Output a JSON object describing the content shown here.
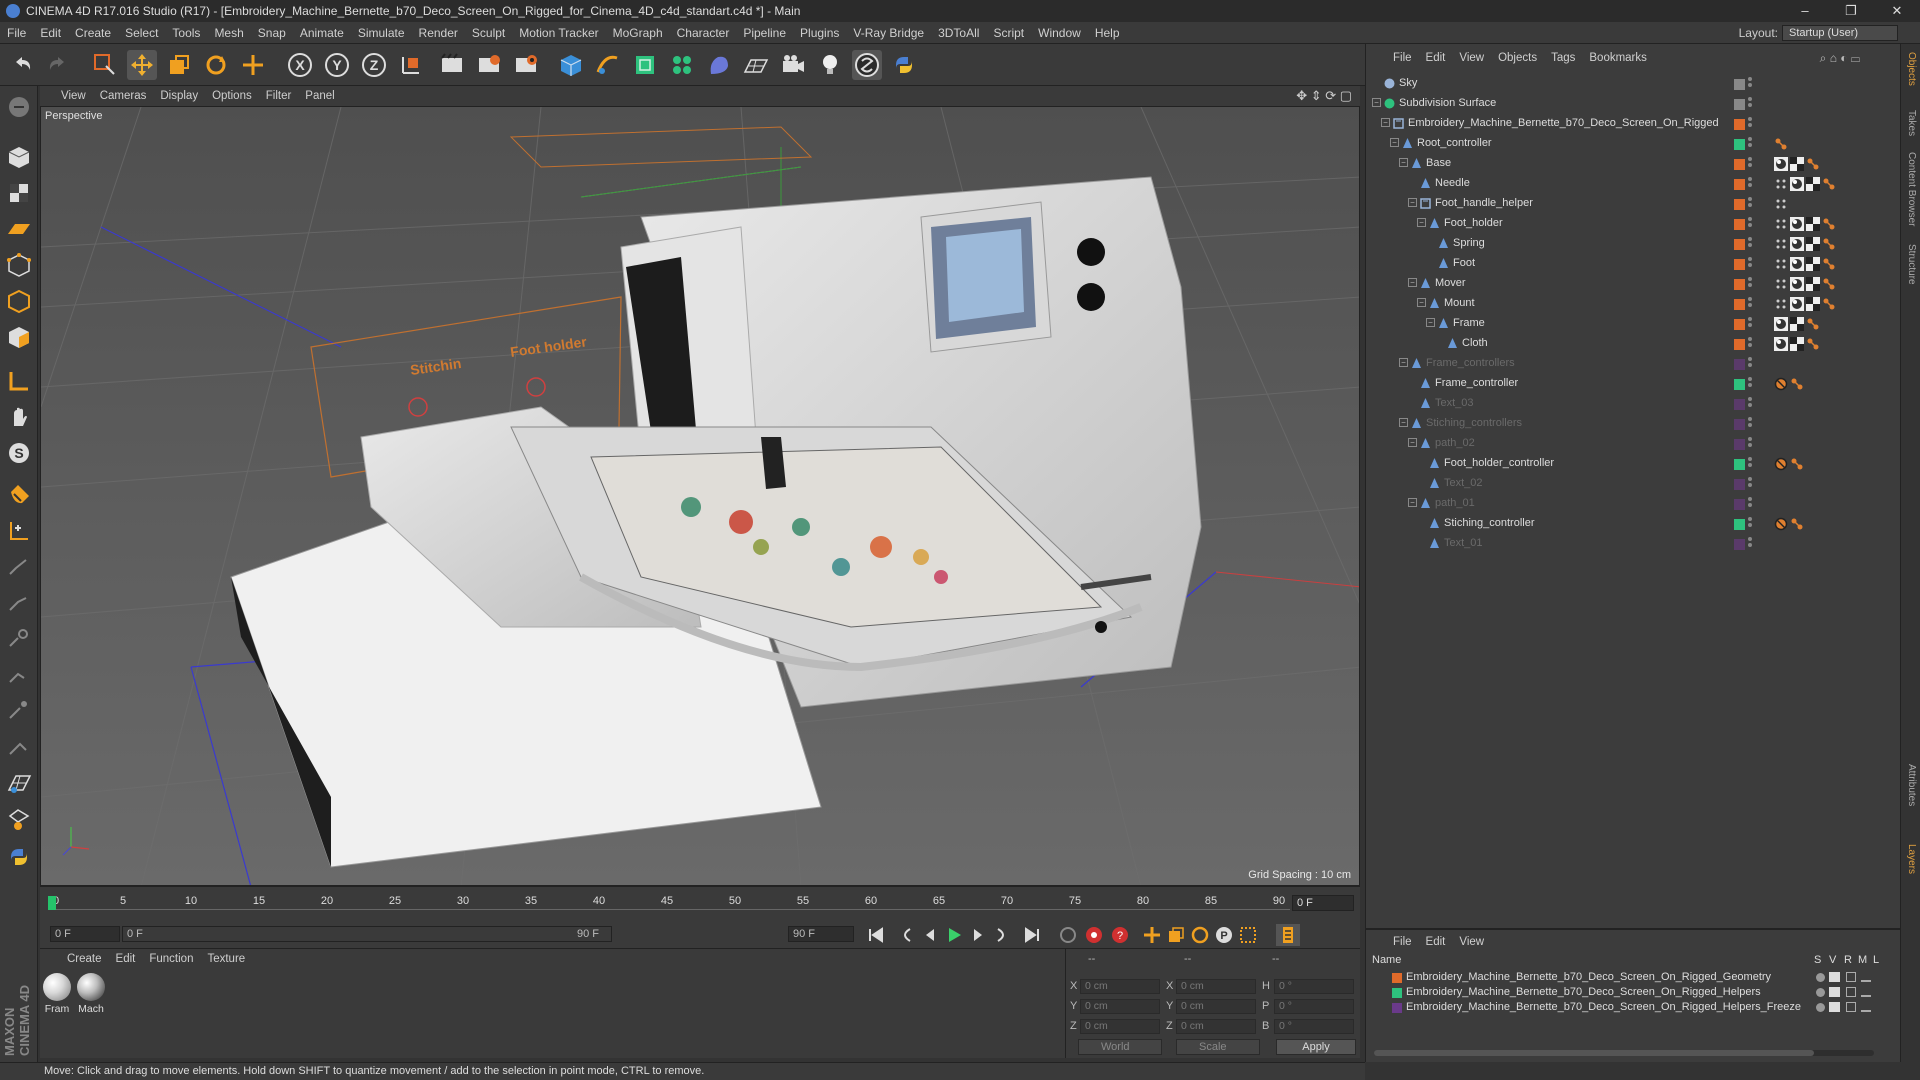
{
  "window": {
    "title": "CINEMA 4D R17.016 Studio (R17) - [Embroidery_Machine_Bernette_b70_Deco_Screen_On_Rigged_for_Cinema_4D_c4d_standart.c4d *] - Main",
    "minimize": "–",
    "maximize": "❐",
    "close": "✕"
  },
  "menubar": {
    "items": [
      "File",
      "Edit",
      "Create",
      "Select",
      "Tools",
      "Mesh",
      "Snap",
      "Animate",
      "Simulate",
      "Render",
      "Sculpt",
      "Motion Tracker",
      "MoGraph",
      "Character",
      "Pipeline",
      "Plugins",
      "V-Ray Bridge",
      "3DToAll",
      "Script",
      "Window",
      "Help"
    ],
    "layout_label": "Layout:",
    "layout_value": "Startup (User)"
  },
  "viewport": {
    "menu": [
      "View",
      "Cameras",
      "Display",
      "Options",
      "Filter",
      "Panel"
    ],
    "label": "Perspective",
    "grid_spacing": "Grid Spacing : 10 cm",
    "overlay_labels": [
      "Stitchin",
      "Foot holder"
    ]
  },
  "timeline": {
    "ticks": [
      "0",
      "5",
      "10",
      "15",
      "20",
      "25",
      "30",
      "35",
      "40",
      "45",
      "50",
      "55",
      "60",
      "65",
      "70",
      "75",
      "80",
      "85",
      "90"
    ],
    "current_frame": "0 F"
  },
  "transport": {
    "start_frame": "0 F",
    "slider_start": "0 F",
    "slider_end": "90 F",
    "end_frame": "90 F"
  },
  "materials": {
    "menu": [
      "Create",
      "Edit",
      "Function",
      "Texture"
    ],
    "items": [
      {
        "label": "Fram",
        "color": "#d8d8d8"
      },
      {
        "label": "Mach",
        "color": "#bdbdbd"
      }
    ]
  },
  "coordinates": {
    "header": [
      "--",
      "--",
      "--"
    ],
    "rows": [
      {
        "a": "X",
        "av": "0 cm",
        "b": "X",
        "bv": "0 cm",
        "c": "H",
        "cv": "0 °"
      },
      {
        "a": "Y",
        "av": "0 cm",
        "b": "Y",
        "bv": "0 cm",
        "c": "P",
        "cv": "0 °"
      },
      {
        "a": "Z",
        "av": "0 cm",
        "b": "Z",
        "bv": "0 cm",
        "c": "B",
        "cv": "0 °"
      }
    ],
    "world": "World",
    "scale": "Scale",
    "apply": "Apply"
  },
  "status": "Move: Click and drag to move elements. Hold down SHIFT to quantize movement / add to the selection in point mode, CTRL to remove.",
  "object_manager": {
    "menu": [
      "File",
      "Edit",
      "View",
      "Objects",
      "Tags",
      "Bookmarks"
    ],
    "objects": [
      {
        "name": "Sky",
        "level": 0,
        "color": "#888888",
        "type": "sky",
        "dim": false,
        "tags": []
      },
      {
        "name": "Subdivision Surface",
        "level": 0,
        "color": "#888888",
        "type": "subdiv",
        "dim": false,
        "tags": []
      },
      {
        "name": "Embroidery_Machine_Bernette_b70_Deco_Screen_On_Rigged",
        "level": 1,
        "color": "#e06a2a",
        "type": "null",
        "dim": false,
        "tags": []
      },
      {
        "name": "Root_controller",
        "level": 2,
        "color": "#2ec27e",
        "type": "joint",
        "dim": false,
        "tags": [
          "ik"
        ]
      },
      {
        "name": "Base",
        "level": 3,
        "color": "#e06a2a",
        "type": "joint",
        "dim": false,
        "tags": [
          "phong",
          "checker",
          "ik"
        ]
      },
      {
        "name": "Needle",
        "level": 4,
        "color": "#e06a2a",
        "type": "joint",
        "dim": false,
        "tags": [
          "dots",
          "phong",
          "checker",
          "ik"
        ]
      },
      {
        "name": "Foot_handle_helper",
        "level": 4,
        "color": "#e06a2a",
        "type": "null",
        "dim": false,
        "tags": [
          "dots"
        ]
      },
      {
        "name": "Foot_holder",
        "level": 5,
        "color": "#e06a2a",
        "type": "joint",
        "dim": false,
        "tags": [
          "dots",
          "phong",
          "checker",
          "ik"
        ]
      },
      {
        "name": "Spring",
        "level": 6,
        "color": "#e06a2a",
        "type": "joint",
        "dim": false,
        "tags": [
          "dots",
          "phong",
          "checker",
          "ik"
        ]
      },
      {
        "name": "Foot",
        "level": 6,
        "color": "#e06a2a",
        "type": "joint",
        "dim": false,
        "tags": [
          "dots",
          "phong",
          "checker",
          "ik"
        ]
      },
      {
        "name": "Mover",
        "level": 4,
        "color": "#e06a2a",
        "type": "joint",
        "dim": false,
        "tags": [
          "dots",
          "phong",
          "checker",
          "ik"
        ]
      },
      {
        "name": "Mount",
        "level": 5,
        "color": "#e06a2a",
        "type": "joint",
        "dim": false,
        "tags": [
          "dots",
          "phong",
          "checker",
          "ik"
        ]
      },
      {
        "name": "Frame",
        "level": 6,
        "color": "#e06a2a",
        "type": "joint",
        "dim": false,
        "tags": [
          "phong",
          "checker",
          "ik"
        ]
      },
      {
        "name": "Cloth",
        "level": 7,
        "color": "#e06a2a",
        "type": "joint",
        "dim": false,
        "tags": [
          "phong",
          "checker",
          "ik"
        ]
      },
      {
        "name": "Frame_controllers",
        "level": 3,
        "color": "#5a3a6a",
        "type": "joint",
        "dim": true,
        "tags": []
      },
      {
        "name": "Frame_controller",
        "level": 4,
        "color": "#2ec27e",
        "type": "joint",
        "dim": false,
        "tags": [
          "ban",
          "ik"
        ]
      },
      {
        "name": "Text_03",
        "level": 4,
        "color": "#5a3a6a",
        "type": "joint",
        "dim": true,
        "tags": []
      },
      {
        "name": "Stiching_controllers",
        "level": 3,
        "color": "#5a3a6a",
        "type": "joint",
        "dim": true,
        "tags": []
      },
      {
        "name": "path_02",
        "level": 4,
        "color": "#5a3a6a",
        "type": "joint",
        "dim": true,
        "tags": []
      },
      {
        "name": "Foot_holder_controller",
        "level": 5,
        "color": "#2ec27e",
        "type": "joint",
        "dim": false,
        "tags": [
          "ban",
          "ik"
        ]
      },
      {
        "name": "Text_02",
        "level": 5,
        "color": "#5a3a6a",
        "type": "joint",
        "dim": true,
        "tags": []
      },
      {
        "name": "path_01",
        "level": 4,
        "color": "#5a3a6a",
        "type": "joint",
        "dim": true,
        "tags": []
      },
      {
        "name": "Stiching_controller",
        "level": 5,
        "color": "#2ec27e",
        "type": "joint",
        "dim": false,
        "tags": [
          "ban",
          "ik"
        ]
      },
      {
        "name": "Text_01",
        "level": 5,
        "color": "#5a3a6a",
        "type": "joint",
        "dim": true,
        "tags": []
      }
    ]
  },
  "right_tabs": [
    "Objects",
    "Takes",
    "Content Browser",
    "Structure",
    "Attributes",
    "Layers"
  ],
  "layer_manager": {
    "menu": [
      "File",
      "Edit",
      "View"
    ],
    "header_name": "Name",
    "header_cols": [
      "S",
      "V",
      "R",
      "M",
      "L"
    ],
    "layers": [
      {
        "name": "Embroidery_Machine_Bernette_b70_Deco_Screen_On_Rigged_Geometry",
        "color": "#e06a2a"
      },
      {
        "name": "Embroidery_Machine_Bernette_b70_Deco_Screen_On_Rigged_Helpers",
        "color": "#2ec27e"
      },
      {
        "name": "Embroidery_Machine_Bernette_b70_Deco_Screen_On_Rigged_Helpers_Freeze",
        "color": "#6a3a8a"
      }
    ]
  }
}
